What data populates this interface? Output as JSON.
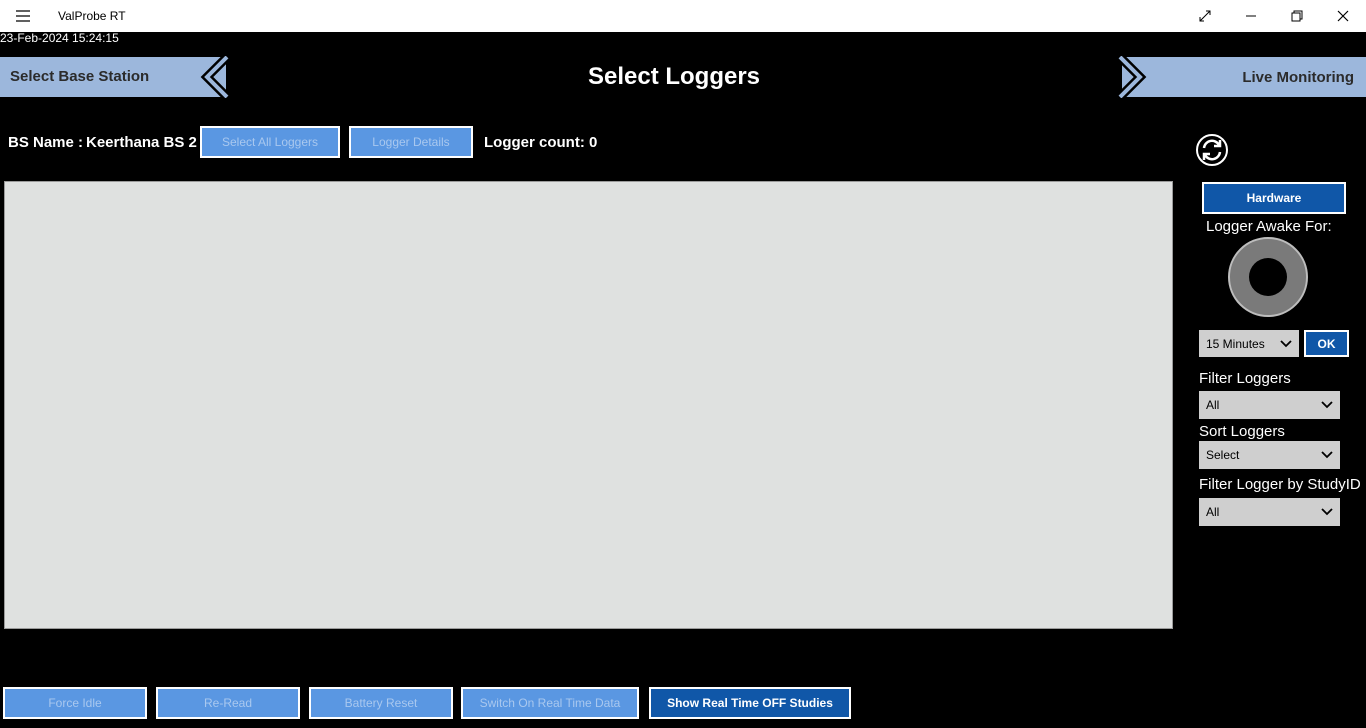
{
  "titlebar": {
    "app_title": "ValProbe RT",
    "icons": [
      "menu-icon",
      "fullscreen-icon",
      "minimize-icon",
      "restore-icon",
      "close-icon"
    ]
  },
  "datetime": "23-Feb-2024 15:24:15",
  "nav": {
    "left_label": "Select Base Station",
    "title": "Select Loggers",
    "right_label": "Live Monitoring"
  },
  "info": {
    "bs_name_label": "BS Name :",
    "bs_name_value": "Keerthana BS 2",
    "select_all_label": "Select All Loggers",
    "logger_details_label": "Logger Details",
    "logger_count": "Logger count: 0"
  },
  "right_panel": {
    "hardware_label": "Hardware",
    "awake_label": "Logger Awake For:",
    "awake_value": "15 Minutes",
    "ok_label": "OK",
    "filter_label": "Filter Loggers",
    "filter_value": "All",
    "sort_label": "Sort Loggers",
    "sort_value": "Select",
    "study_label": "Filter Logger by StudyID",
    "study_value": "All"
  },
  "bottom_buttons": {
    "force_idle": "Force Idle",
    "re_read": "Re-Read",
    "battery_reset": "Battery Reset",
    "switch_on": "Switch On Real Time Data",
    "show_real_time": "Show Real Time OFF Studies"
  },
  "colors": {
    "nav_bg": "#9cb7dc",
    "button_light": "#5a97e2",
    "button_dark": "#1057a8",
    "list_bg": "#dfe1e0"
  }
}
